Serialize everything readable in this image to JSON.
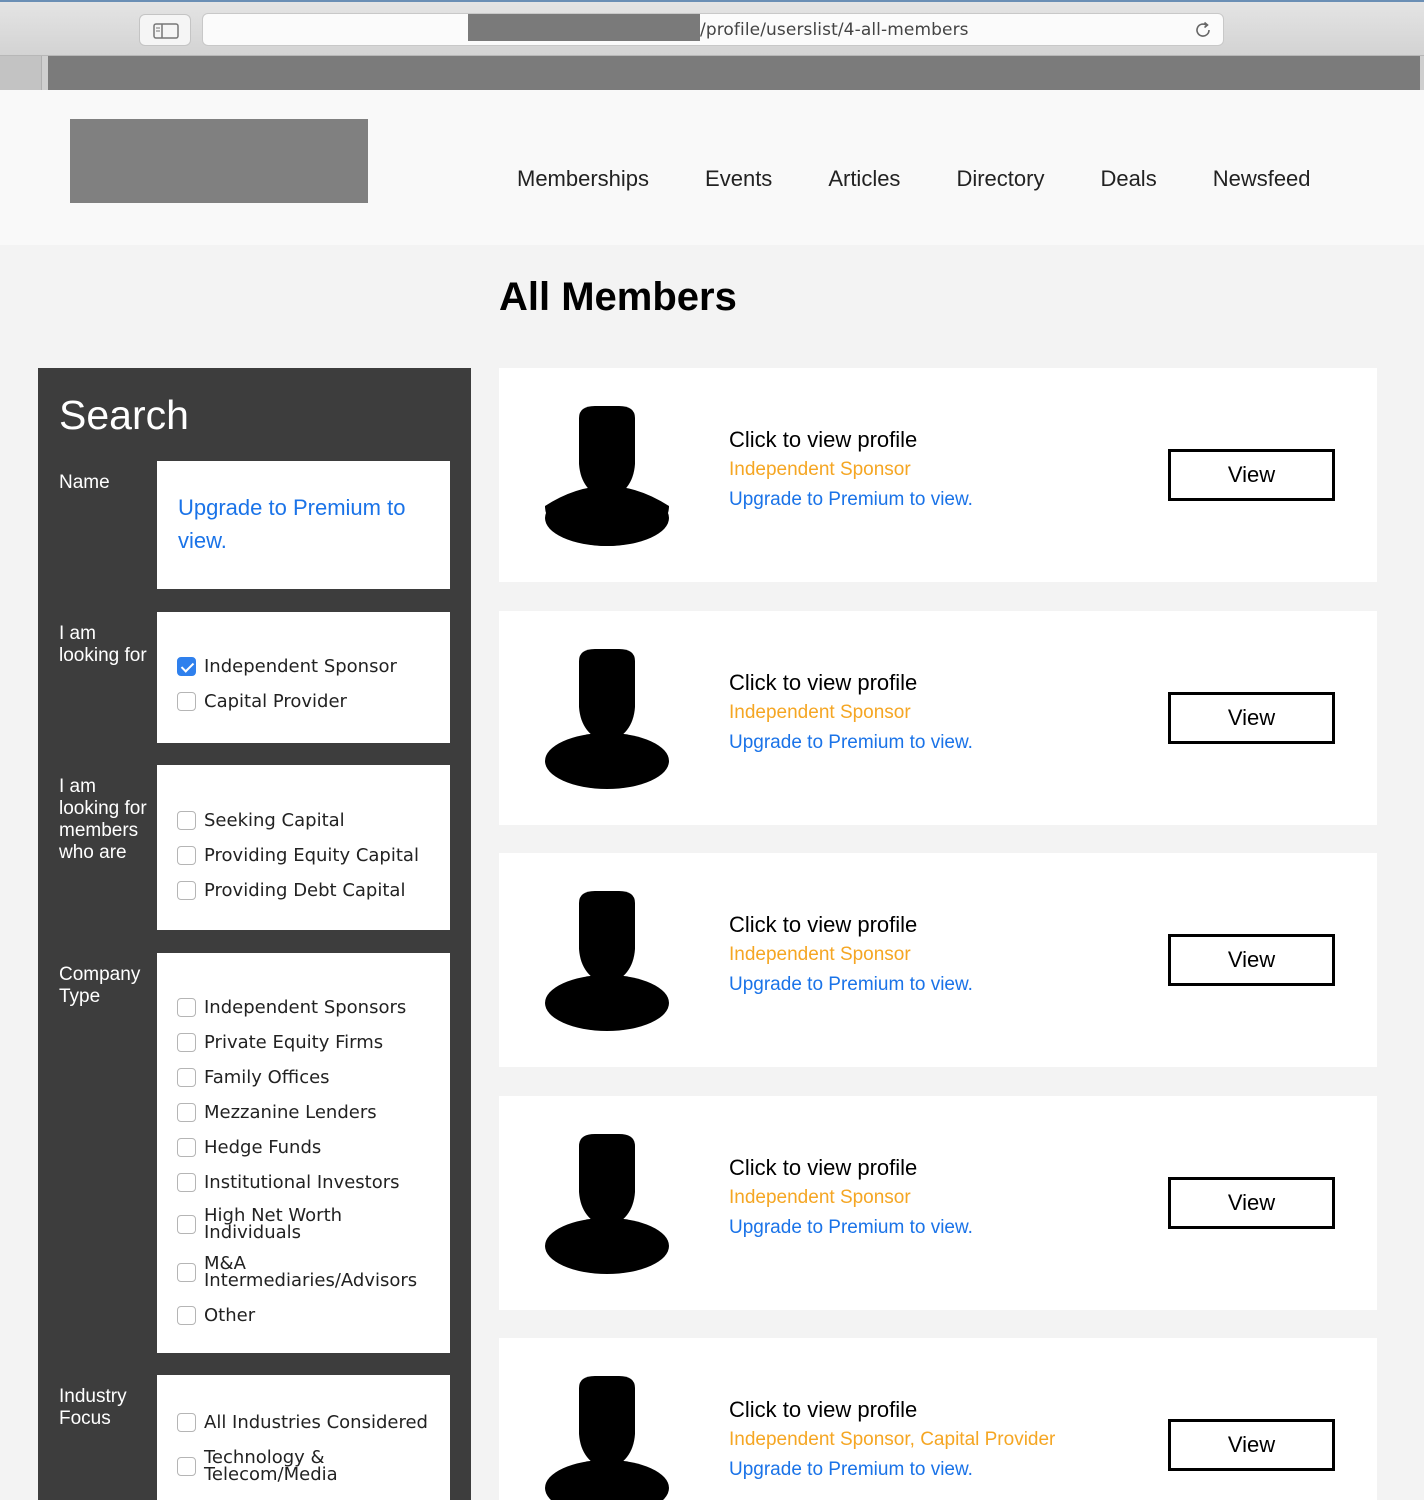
{
  "browser": {
    "url": "/profile/userslist/4-all-members"
  },
  "nav": {
    "items": [
      "Memberships",
      "Events",
      "Articles",
      "Directory",
      "Deals",
      "Newsfeed"
    ]
  },
  "page": {
    "title": "All Members"
  },
  "search": {
    "title": "Search",
    "name_label": "Name",
    "name_upgrade": "Upgrade to Premium to view.",
    "looking_for": {
      "label": "I am looking for",
      "options": [
        {
          "label": "Independent Sponsor",
          "checked": true
        },
        {
          "label": "Capital Provider",
          "checked": false
        }
      ]
    },
    "members_who_are": {
      "label": "I am looking for members who are",
      "options": [
        {
          "label": "Seeking Capital",
          "checked": false
        },
        {
          "label": "Providing Equity Capital",
          "checked": false
        },
        {
          "label": "Providing Debt Capital",
          "checked": false
        }
      ]
    },
    "company_type": {
      "label": "Company Type",
      "options": [
        {
          "label": "Independent Sponsors",
          "checked": false
        },
        {
          "label": "Private Equity Firms",
          "checked": false
        },
        {
          "label": "Family Offices",
          "checked": false
        },
        {
          "label": "Mezzanine Lenders",
          "checked": false
        },
        {
          "label": "Hedge Funds",
          "checked": false
        },
        {
          "label": "Institutional Investors",
          "checked": false
        },
        {
          "label": "High Net Worth Individuals",
          "checked": false
        },
        {
          "label": "M&A Intermediaries/Advisors",
          "checked": false
        },
        {
          "label": "Other",
          "checked": false
        }
      ]
    },
    "industry_focus": {
      "label": "Industry Focus",
      "options": [
        {
          "label": "All Industries Considered",
          "checked": false
        },
        {
          "label": "Technology & Telecom/Media",
          "checked": false
        }
      ]
    }
  },
  "members": [
    {
      "title": "Click to view profile",
      "role": "Independent Sponsor",
      "upgrade": "Upgrade to Premium to view.",
      "button": "View"
    },
    {
      "title": "Click to view profile",
      "role": "Independent Sponsor",
      "upgrade": "Upgrade to Premium to view.",
      "button": "View"
    },
    {
      "title": "Click to view profile",
      "role": "Independent Sponsor",
      "upgrade": "Upgrade to Premium to view.",
      "button": "View"
    },
    {
      "title": "Click to view profile",
      "role": "Independent Sponsor",
      "upgrade": "Upgrade to Premium to view.",
      "button": "View"
    },
    {
      "title": "Click to view profile",
      "role": "Independent Sponsor, Capital Provider",
      "upgrade": "Upgrade to Premium to view.",
      "button": "View"
    }
  ],
  "colors": {
    "link": "#1a73e8",
    "role": "#f5a623",
    "panel": "#3d3d3d",
    "checkbox_checked": "#2f80ed"
  },
  "icons": {
    "sidebar": "sidebar-icon",
    "reload": "reload-icon",
    "avatar": "person-silhouette-icon",
    "checkbox": "checkbox-icon"
  }
}
